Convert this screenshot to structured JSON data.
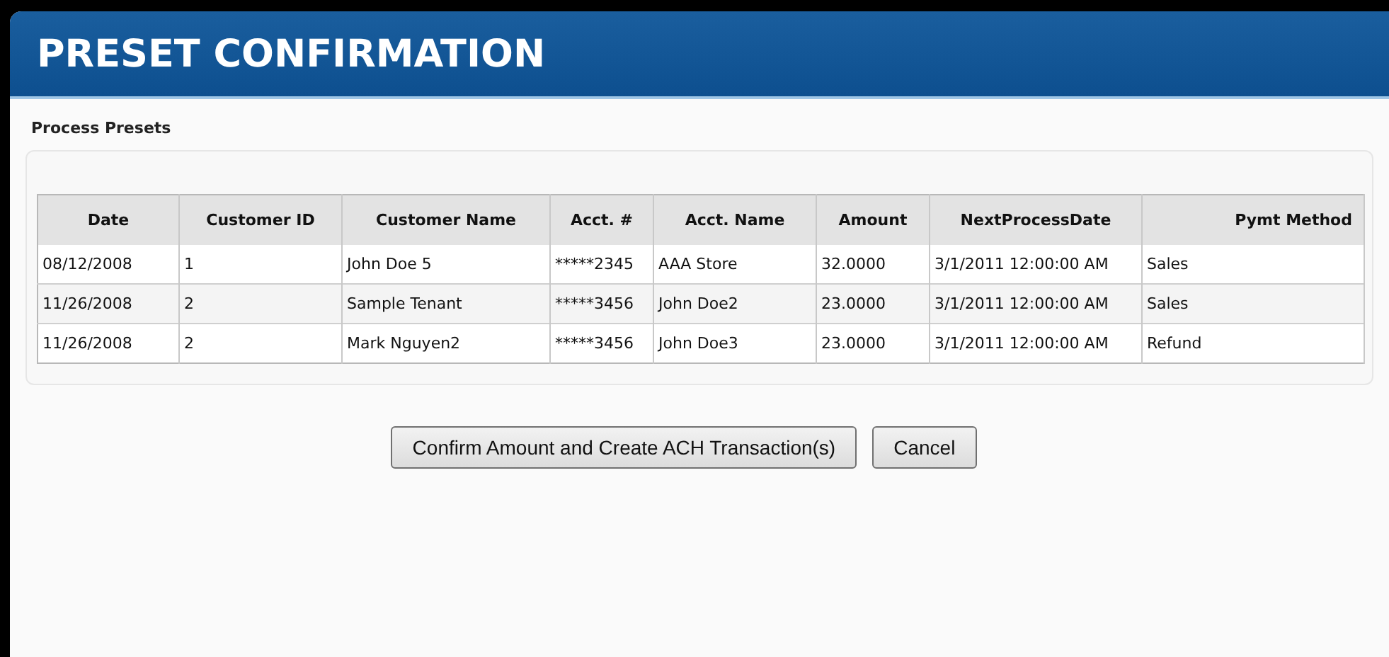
{
  "window": {
    "title": "PRESET CONFIRMATION"
  },
  "section": {
    "label": "Process Presets"
  },
  "table": {
    "columns": [
      "Date",
      "Customer ID",
      "Customer Name",
      "Acct. #",
      "Acct. Name",
      "Amount",
      "NextProcessDate",
      "Pymt Method"
    ],
    "rows": [
      [
        "08/12/2008",
        "1",
        "John Doe 5",
        "*****2345",
        "AAA Store",
        "32.0000",
        "3/1/2011 12:00:00 AM",
        "Sales"
      ],
      [
        "11/26/2008",
        "2",
        "Sample Tenant",
        "*****3456",
        "John Doe2",
        "23.0000",
        "3/1/2011 12:00:00 AM",
        "Sales"
      ],
      [
        "11/26/2008",
        "2",
        "Mark Nguyen2",
        "*****3456",
        "John Doe3",
        "23.0000",
        "3/1/2011 12:00:00 AM",
        "Refund"
      ]
    ]
  },
  "buttons": [
    "Confirm Amount and Create ACH Transaction(s)",
    "Cancel"
  ]
}
